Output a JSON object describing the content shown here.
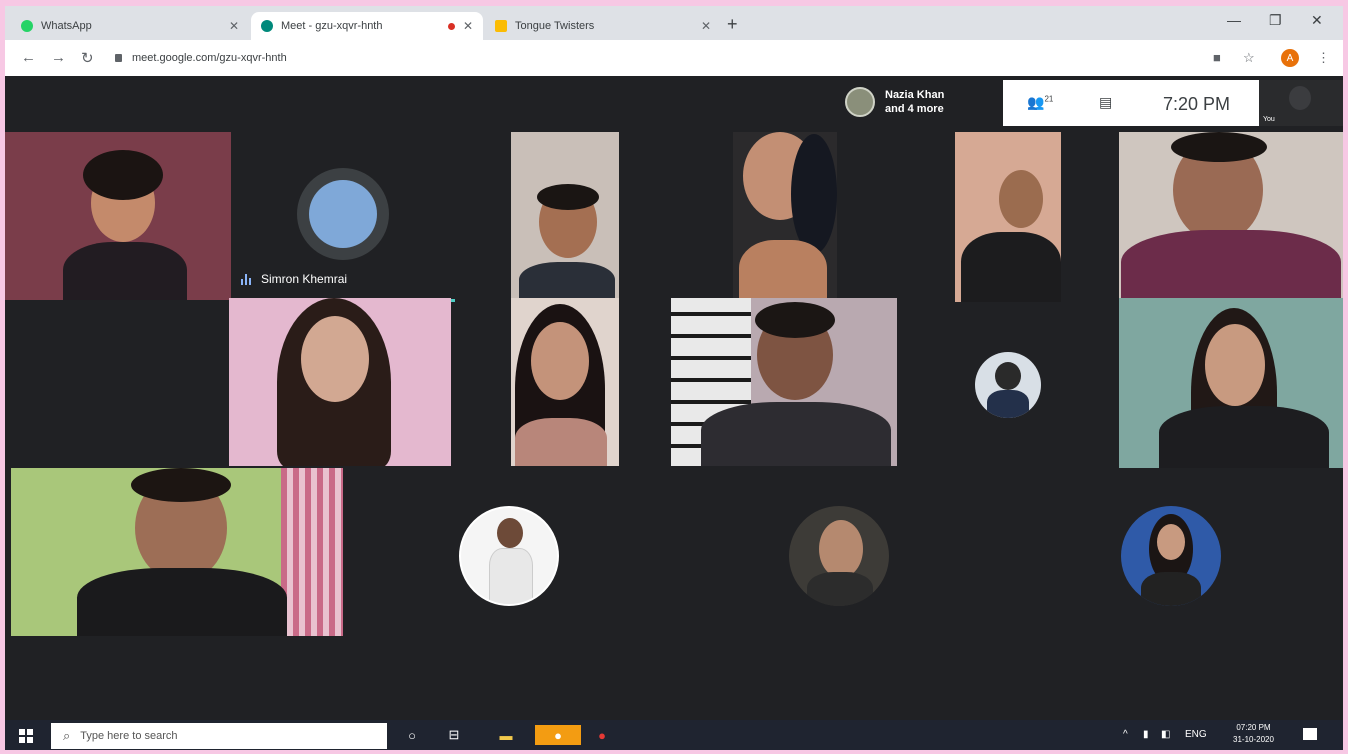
{
  "browser": {
    "tabs": [
      {
        "label": "WhatsApp"
      },
      {
        "label": "Meet - gzu-xqvr-hnth"
      },
      {
        "label": "Tongue Twisters"
      }
    ],
    "new_tab": "+",
    "url": "meet.google.com/gzu-xqvr-hnth",
    "profile_initial": "A"
  },
  "meet": {
    "presenter": {
      "line1": "Nazia Khan",
      "line2": "and 4 more"
    },
    "participants_count": "21",
    "clock": "7:20 PM",
    "self_label": "You",
    "speaker_name": "Simron Khemrai"
  },
  "taskbar": {
    "search_placeholder": "Type here to search",
    "lang": "ENG",
    "time": "07:20 PM",
    "date": "31-10-2020"
  },
  "colors": {
    "page_bg": "#202124",
    "accent": "#4ecdc4",
    "border": "#f7c8e4"
  }
}
